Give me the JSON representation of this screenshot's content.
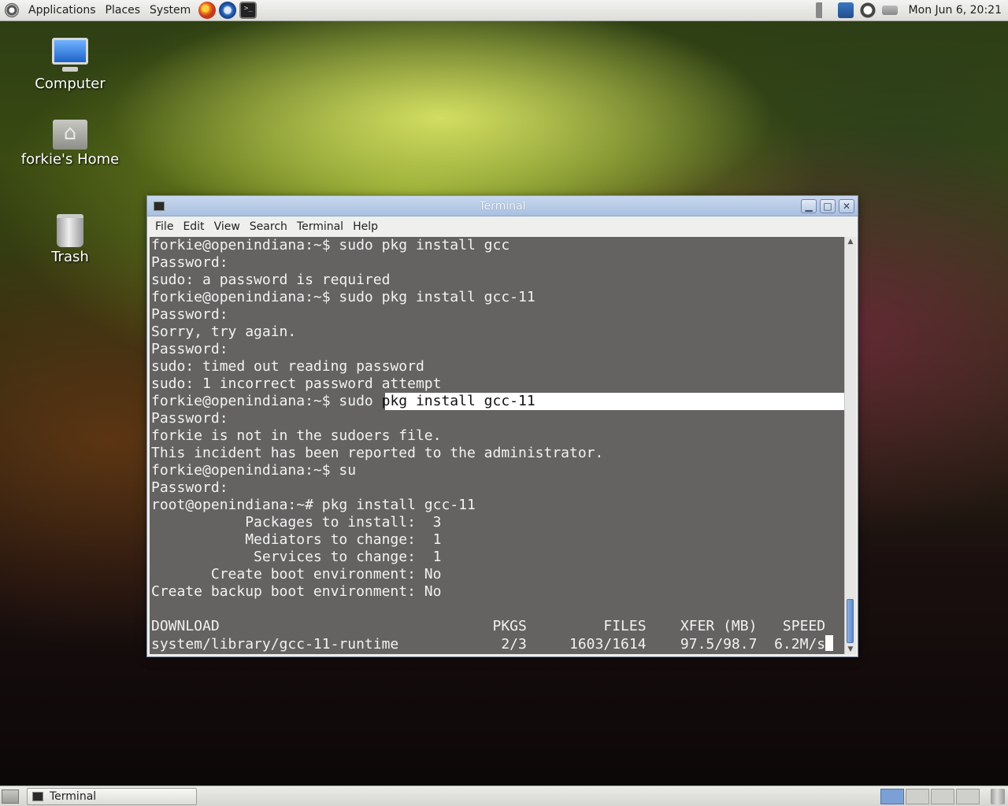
{
  "top_panel": {
    "menus": [
      "Applications",
      "Places",
      "System"
    ],
    "launchers": [
      "firefox-icon",
      "thunderbird-icon",
      "terminal-launcher-icon"
    ],
    "clock": "Mon Jun  6, 20:21"
  },
  "desktop_icons": [
    {
      "label": "Computer",
      "icon": "computer-icon"
    },
    {
      "label": "forkie's Home",
      "icon": "home-folder-icon"
    },
    {
      "label": "Trash",
      "icon": "trash-icon"
    }
  ],
  "window": {
    "title": "Terminal",
    "menu": [
      "File",
      "Edit",
      "View",
      "Search",
      "Terminal",
      "Help"
    ]
  },
  "terminal": {
    "lines": [
      "forkie@openindiana:~$ sudo pkg install gcc",
      "Password:",
      "sudo: a password is required",
      "forkie@openindiana:~$ sudo pkg install gcc-11",
      "Password:",
      "Sorry, try again.",
      "Password:",
      "sudo: timed out reading password",
      "sudo: 1 incorrect password attempt"
    ],
    "highlight_line": {
      "prefix": "forkie@openindiana:~$ sudo ",
      "selected": "pkg install gcc-11"
    },
    "lines_after": [
      "Password:",
      "forkie is not in the sudoers file.",
      "This incident has been reported to the administrator.",
      "forkie@openindiana:~$ su",
      "Password:",
      "root@openindiana:~# pkg install gcc-11",
      "           Packages to install:  3",
      "           Mediators to change:  1",
      "            Services to change:  1",
      "       Create boot environment: No",
      "Create backup boot environment: No",
      "",
      "DOWNLOAD                                PKGS         FILES    XFER (MB)   SPEED"
    ],
    "last_line": "system/library/gcc-11-runtime            2/3     1603/1614    97.5/98.7  6.2M/s"
  },
  "taskbar": {
    "task_label": "Terminal"
  }
}
